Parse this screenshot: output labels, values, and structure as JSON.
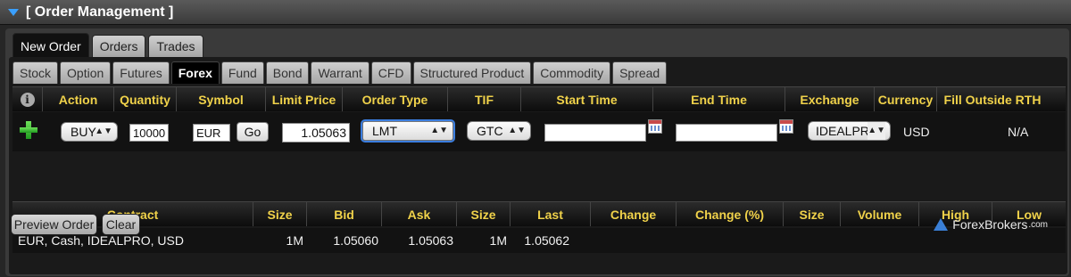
{
  "window": {
    "title": "[ Order Management ]"
  },
  "main_tabs": [
    "New Order",
    "Orders",
    "Trades"
  ],
  "asset_tabs": [
    "Stock",
    "Option",
    "Futures",
    "Forex",
    "Fund",
    "Bond",
    "Warrant",
    "CFD",
    "Structured Product",
    "Commodity",
    "Spread"
  ],
  "order_headers": [
    "Action",
    "Quantity",
    "Symbol",
    "Limit Price",
    "Order Type",
    "TIF",
    "Start Time",
    "End Time",
    "Exchange",
    "Currency",
    "Fill Outside RTH"
  ],
  "order": {
    "action": "BUY",
    "quantity": "10000",
    "symbol": "EUR",
    "go_label": "Go",
    "limit_price": "1.05063",
    "order_type": "LMT",
    "tif": "GTC",
    "start_time": "",
    "end_time": "",
    "exchange": "IDEALPRO",
    "currency": "USD",
    "fill_outside_rth": "N/A"
  },
  "market_headers": [
    "Contract",
    "Size",
    "Bid",
    "Ask",
    "Size",
    "Last",
    "Change",
    "Change (%)",
    "Size",
    "Volume",
    "High",
    "Low"
  ],
  "market_row": {
    "contract": "EUR, Cash, IDEALPRO, USD",
    "bid_size": "1M",
    "bid": "1.05060",
    "ask": "1.05063",
    "ask_size": "1M",
    "last": "1.05062",
    "change": "",
    "change_pct": "",
    "size": "",
    "volume": "",
    "high": "",
    "low": ""
  },
  "buttons": {
    "preview": "Preview Order",
    "clear": "Clear"
  },
  "watermark": {
    "name": "ForexBrokers",
    "domain": ".com"
  },
  "colors": {
    "header_text": "#f0d24a",
    "accent": "#3aa0ff",
    "add_icon": "#2fb52f"
  }
}
